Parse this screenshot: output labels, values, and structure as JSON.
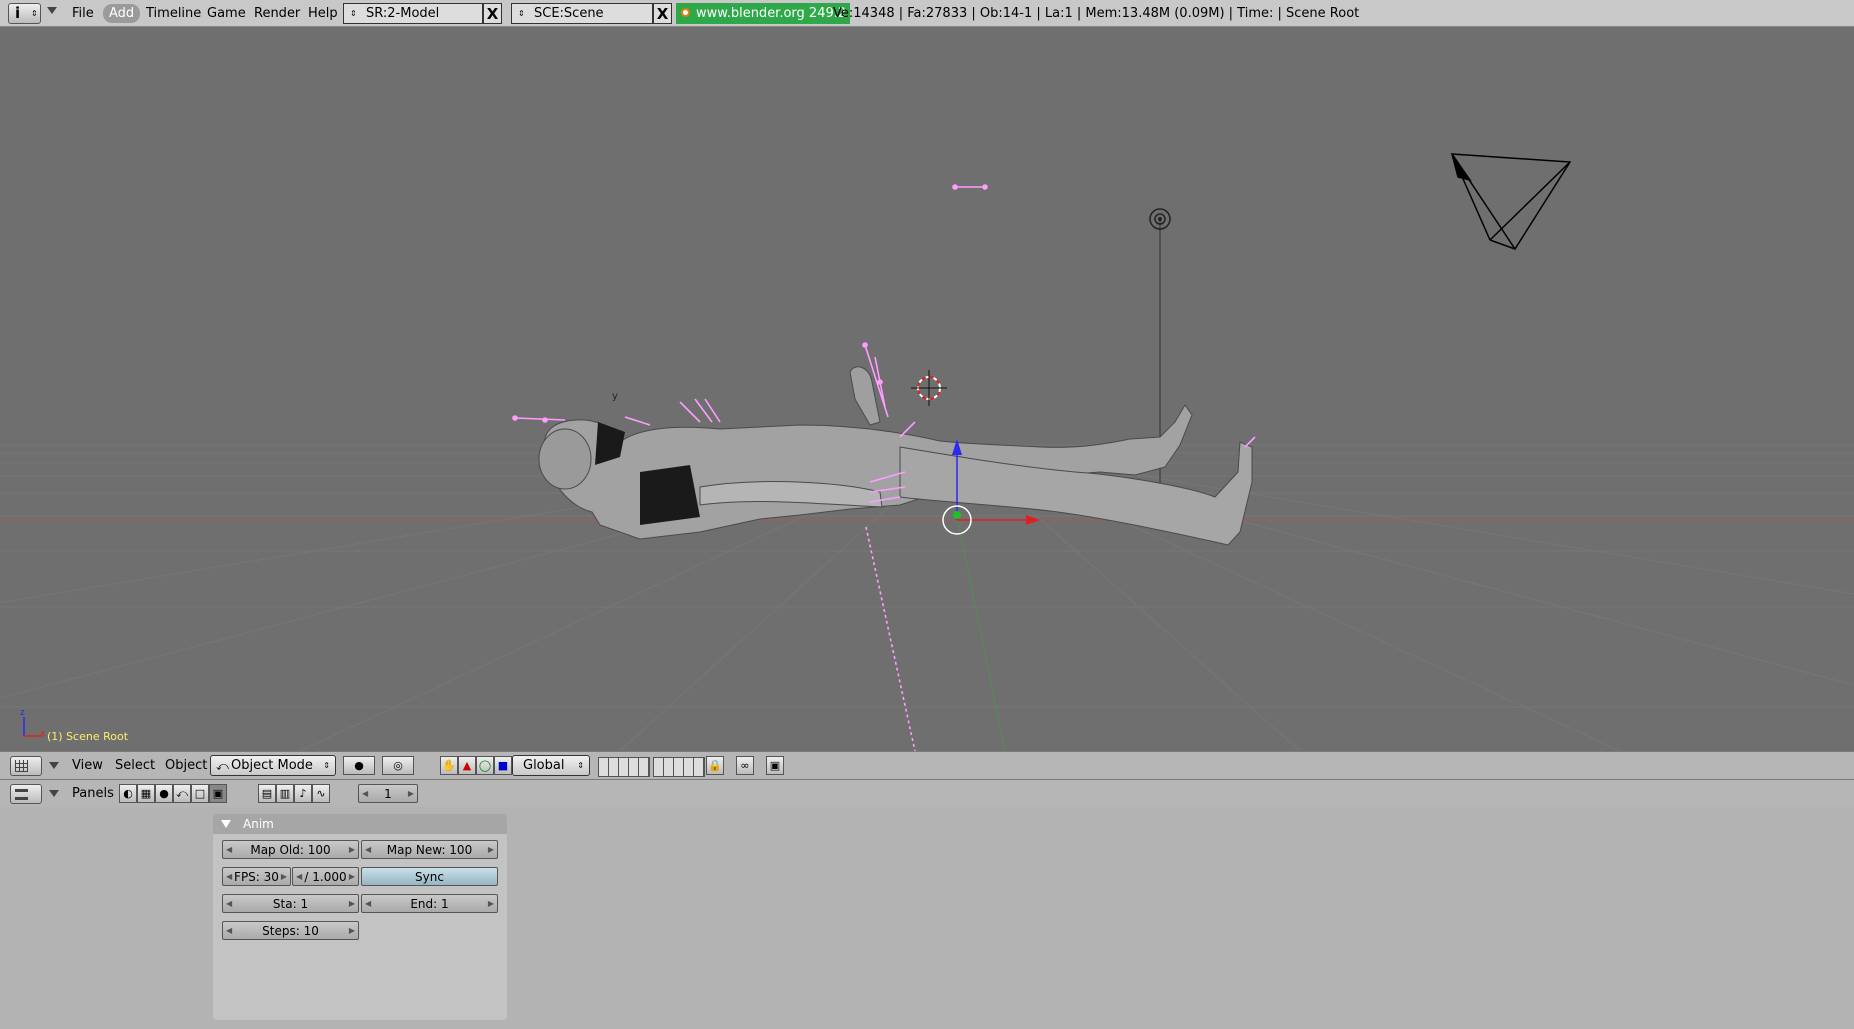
{
  "topbar": {
    "menus": [
      "File",
      "Add",
      "Timeline",
      "Game",
      "Render",
      "Help"
    ],
    "screen_field": "SR:2-Model",
    "scene_field": "SCE:Scene",
    "blender_link": "www.blender.org 249.2",
    "stats": "Ve:14348 | Fa:27833 | Ob:14-1 | La:1  | Mem:13.48M (0.09M)  | Time: | Scene Root",
    "close_glyph": "X"
  },
  "viewport": {
    "label": "(1) Scene Root",
    "axis_z": "z",
    "axis_x": "x",
    "axis_y": "y"
  },
  "view3d_header": {
    "menus": [
      "View",
      "Select",
      "Object"
    ],
    "mode": "Object Mode",
    "orientation": "Global"
  },
  "buttons_header": {
    "panels_label": "Panels",
    "frame": "1"
  },
  "anim_panel": {
    "title": "Anim",
    "map_old": "Map Old: 100",
    "map_new": "Map New: 100",
    "fps": "FPS: 30",
    "fps_base": "/ 1.000",
    "sync": "Sync",
    "start": "Sta: 1",
    "end": "End: 1",
    "steps": "Steps: 10"
  },
  "colors": {
    "viewport_bg": "#6f6f6f",
    "bone": "#ff9cff",
    "blender_green": "#2fa84a",
    "label_yellow": "#ffec6e"
  }
}
